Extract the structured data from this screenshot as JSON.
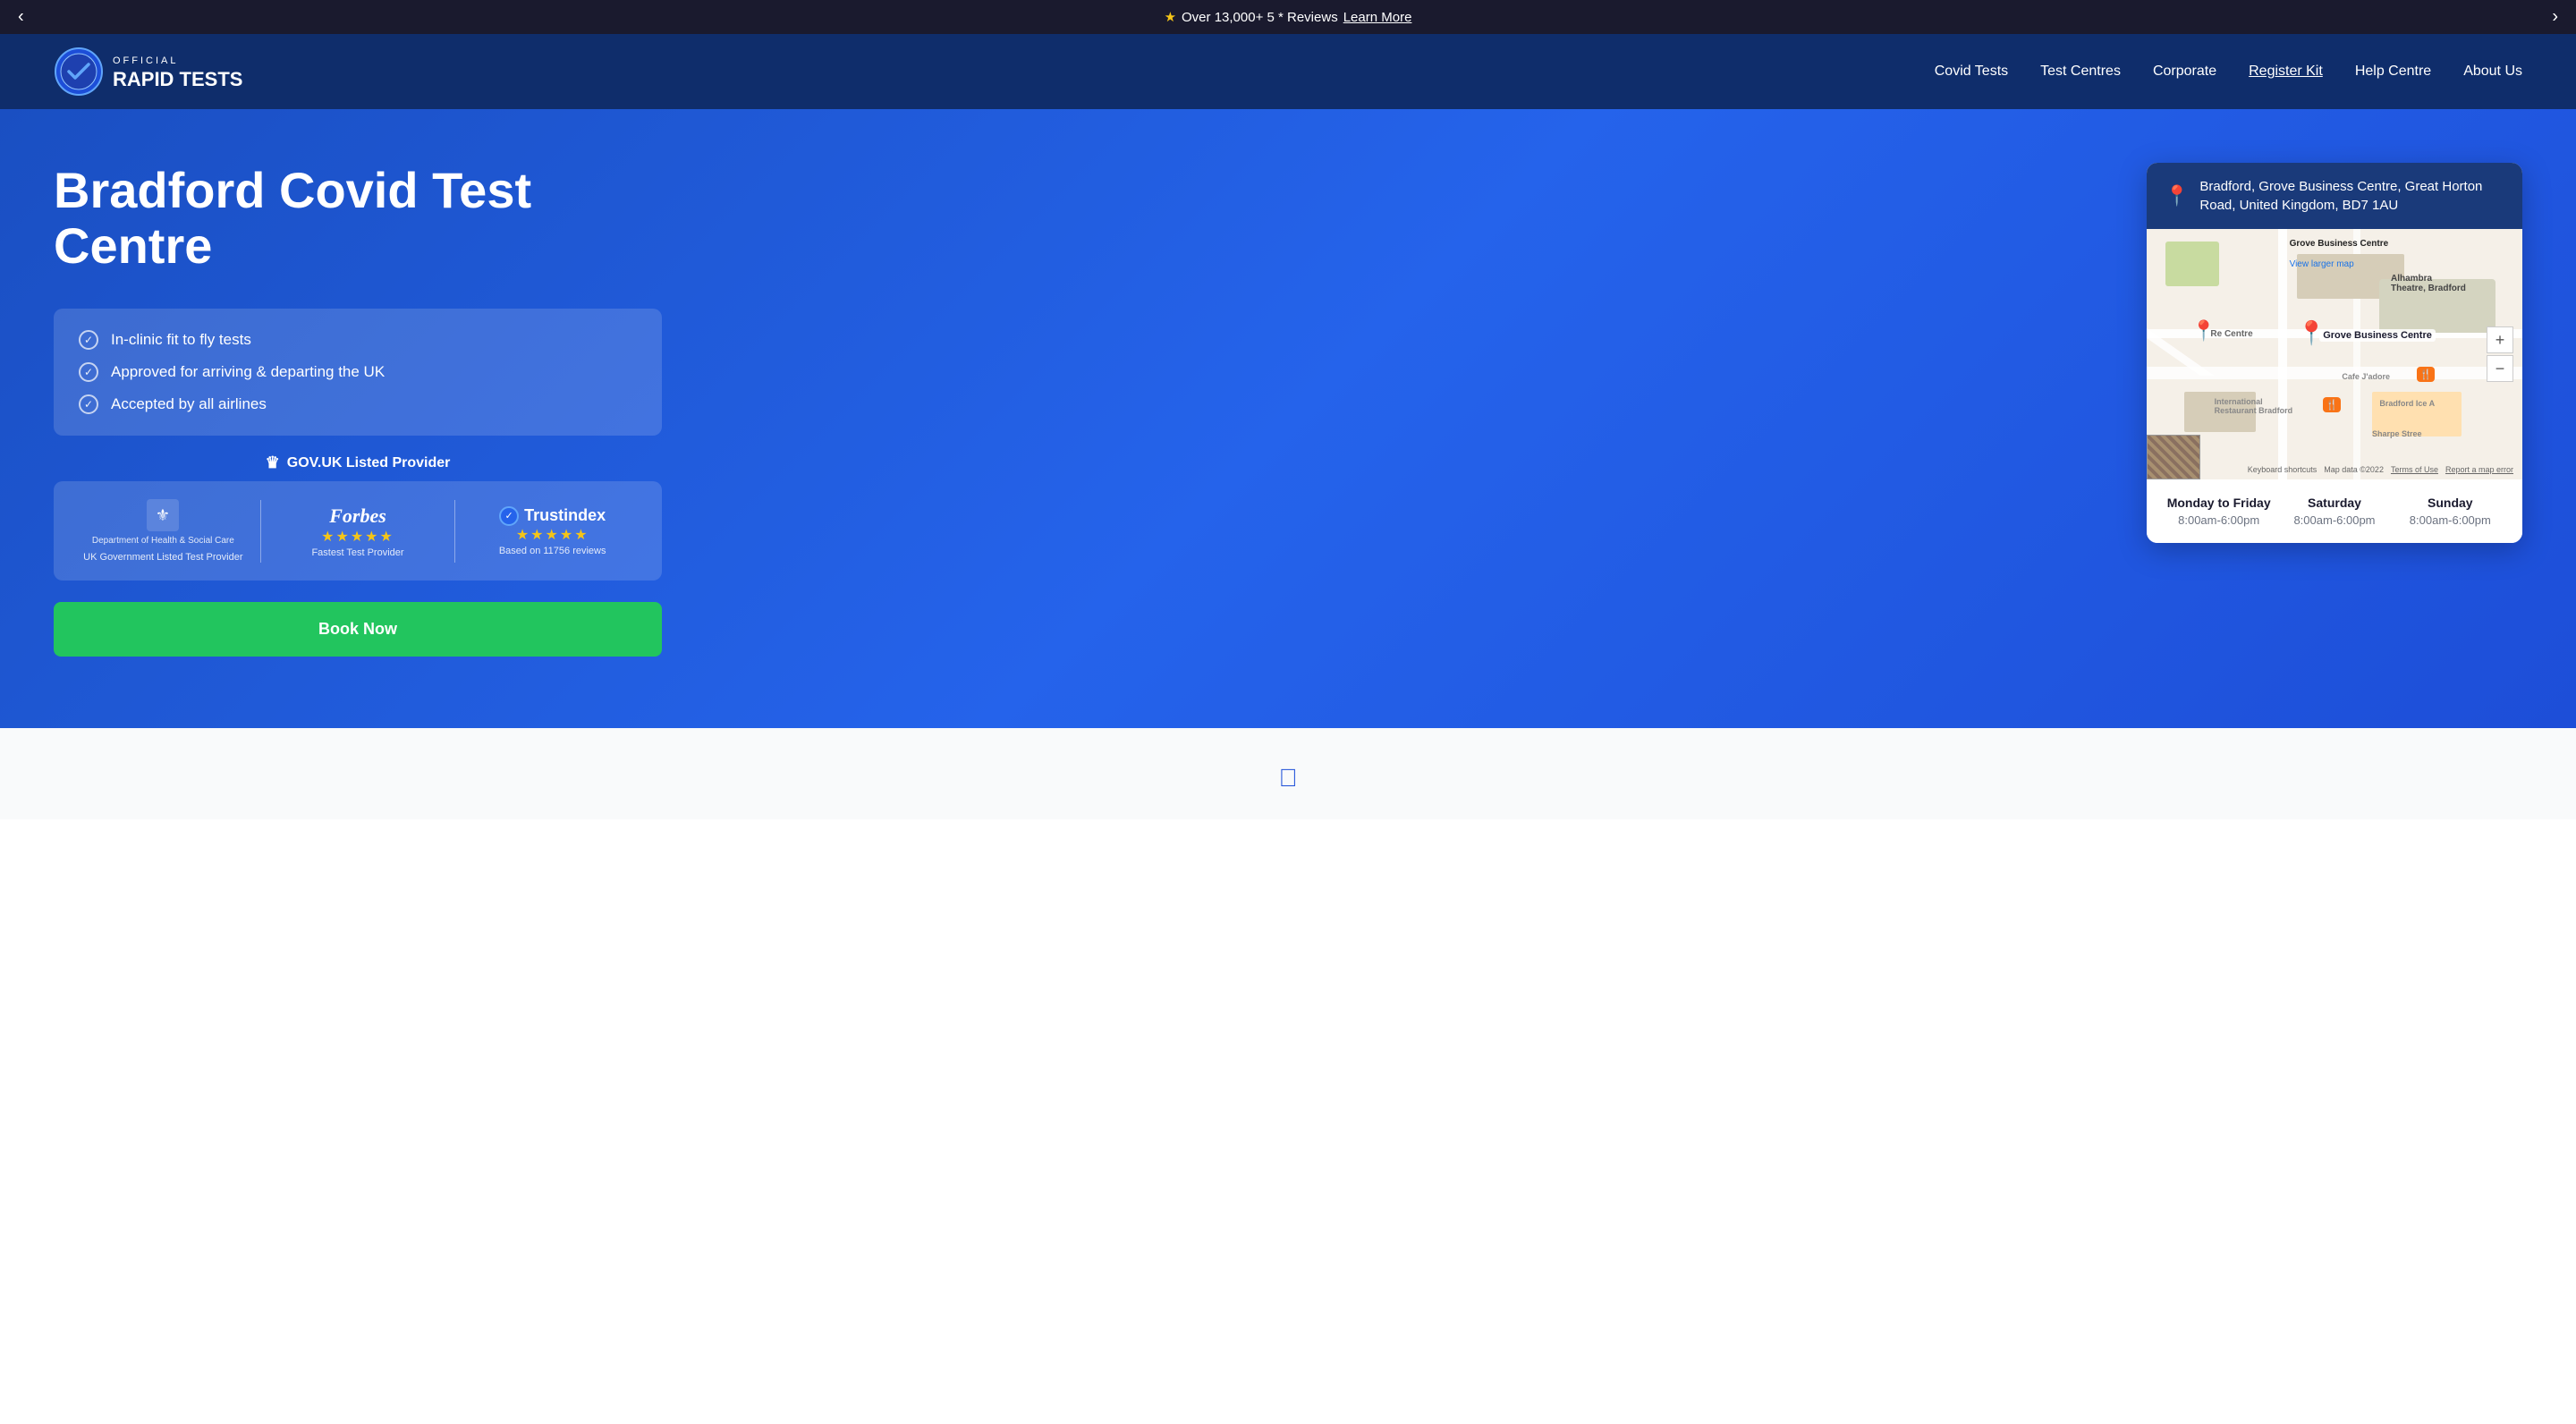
{
  "announcement": {
    "text": "Over 13,000+ 5 * Reviews",
    "link_text": "Learn More",
    "star": "★"
  },
  "nav": {
    "logo_text_top": "OFFICIAL",
    "logo_text_brand": "Rapid Tests",
    "items": [
      {
        "label": "Covid Tests",
        "active": false
      },
      {
        "label": "Test Centres",
        "active": false
      },
      {
        "label": "Corporate",
        "active": false
      },
      {
        "label": "Register Kit",
        "active": true
      },
      {
        "label": "Help Centre",
        "active": false
      },
      {
        "label": "About Us",
        "active": false
      }
    ]
  },
  "hero": {
    "title": "Bradford Covid Test Centre",
    "features": [
      "In-clinic fit to fly tests",
      "Approved for arriving & departing the UK",
      "Accepted by all airlines"
    ],
    "gov_label": "GOV.UK Listed Provider",
    "dept_text": "Department of Health & Social Care",
    "uk_gov_label": "UK Government Listed Test Provider",
    "forbes_label": "Fastest Test Provider",
    "trustindex_label": "Based on 11756 reviews",
    "trustindex_name": "Trustindex",
    "book_btn": "Book Now"
  },
  "map": {
    "address": "Bradford, Grove Business Centre, Great Horton Road, United Kingdom, BD7 1AU",
    "label": "Grove Business Centre",
    "view_larger": "View larger map",
    "hours": [
      {
        "day": "Monday to Friday",
        "time": "8:00am-6:00pm"
      },
      {
        "day": "Saturday",
        "time": "8:00am-6:00pm"
      },
      {
        "day": "Sunday",
        "time": "8:00am-6:00pm"
      }
    ],
    "map_data": "Map data ©2022",
    "terms": "Terms of Use",
    "report": "Report a map error",
    "keyboard": "Keyboard shortcuts"
  }
}
